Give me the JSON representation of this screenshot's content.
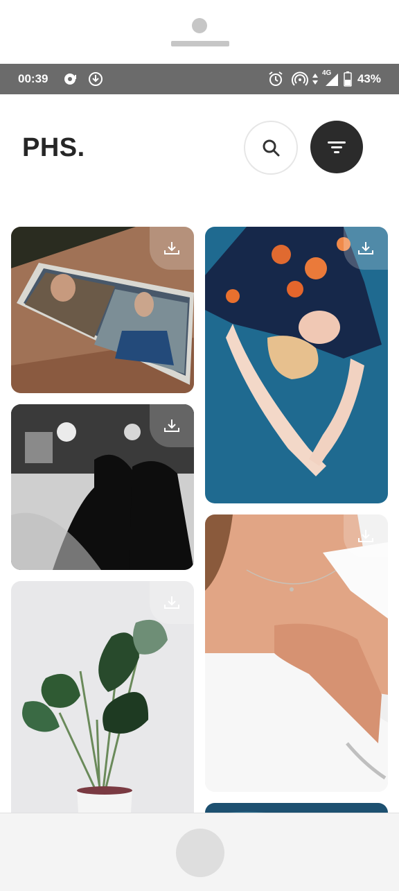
{
  "status_bar": {
    "time": "00:39",
    "network": "4G",
    "battery_percent": "43%",
    "icons": [
      "media-sync-icon",
      "download-icon",
      "alarm-icon",
      "hotspot-icon",
      "data-arrows-icon",
      "signal-icon",
      "battery-icon"
    ]
  },
  "header": {
    "title": "PHS.",
    "search_icon": "search-icon",
    "filter_icon": "filter-icon"
  },
  "photos": [
    {
      "subject": "tablet-photo",
      "column": "left",
      "download_icon": "download-icon"
    },
    {
      "subject": "woman-on-blue-carpet-photo",
      "column": "right",
      "download_icon": "download-icon"
    },
    {
      "subject": "bw-wedding-silhouette-photo",
      "column": "left",
      "download_icon": "download-icon"
    },
    {
      "subject": "necklace-portrait-photo",
      "column": "right",
      "download_icon": "download-icon"
    },
    {
      "subject": "houseplant-photo",
      "column": "left",
      "download_icon": "download-icon"
    },
    {
      "subject": "ocean-photo",
      "column": "right",
      "download_icon": "download-icon"
    }
  ],
  "colors": {
    "title": "#262626",
    "filter_button": "#2b2b2b",
    "status_bar": "#6b6b6b"
  }
}
